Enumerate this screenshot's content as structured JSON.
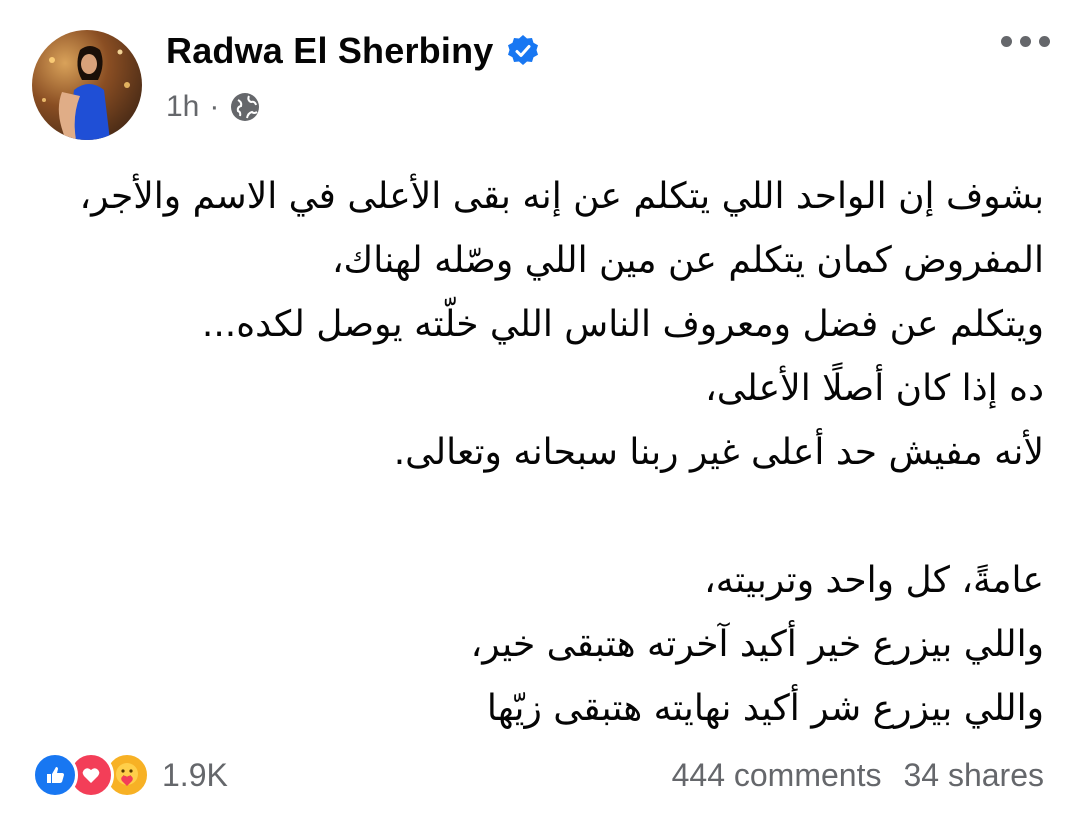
{
  "post": {
    "author": "Radwa El Sherbiny",
    "time": "1h",
    "separator": "·",
    "audience_icon": "globe-icon",
    "verified_icon": "verified-badge-icon",
    "more_icon": "more-options-icon",
    "paragraph1": [
      "بشوف إن الواحد اللي يتكلم عن إنه بقى الأعلى في الاسم والأجر،",
      "المفروض كمان يتكلم عن مين اللي وصّله لهناك،",
      "ويتكلم عن فضل ومعروف الناس اللي خلّته يوصل لكده...",
      "ده إذا كان أصلًا الأعلى،",
      "لأنه مفيش حد أعلى غير ربنا سبحانه وتعالى."
    ],
    "paragraph2": [
      "عامةً، كل واحد وتربيته،",
      "واللي بيزرع خير أكيد آخرته هتبقى خير،",
      "واللي بيزرع شر أكيد نهايته هتبقى زيّها"
    ]
  },
  "footer": {
    "reaction_icons": [
      "like-icon",
      "love-icon",
      "care-icon"
    ],
    "reaction_count": "1.9K",
    "comments": "444 comments",
    "shares": "34 shares"
  },
  "colors": {
    "accent": "#1877f2",
    "secondary_text": "#65676b",
    "love": "#f33e58",
    "care": "#f7b125"
  }
}
